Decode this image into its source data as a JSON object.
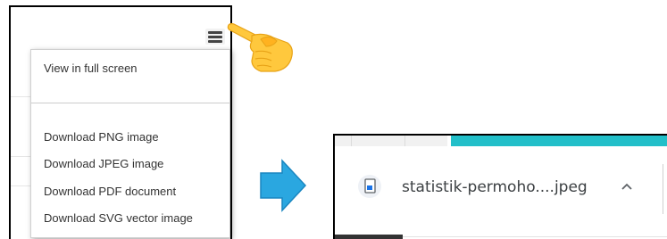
{
  "export_menu": {
    "items": [
      {
        "label": "View in full screen"
      },
      {
        "label": "Download PNG image"
      },
      {
        "label": "Download JPEG image"
      },
      {
        "label": "Download PDF document"
      },
      {
        "label": "Download SVG vector image"
      }
    ],
    "icon": "hamburger-menu-icon"
  },
  "download_shelf": {
    "file_name": "statistik-permoho....jpeg",
    "file_icon": "image-file-icon",
    "expand_icon": "chevron-up-icon",
    "accent_color": "#22bfc9"
  },
  "decorations": {
    "pointer": "pointing-hand-icon",
    "arrow": "right-arrow-icon",
    "arrow_color": "#2aa7e0"
  }
}
